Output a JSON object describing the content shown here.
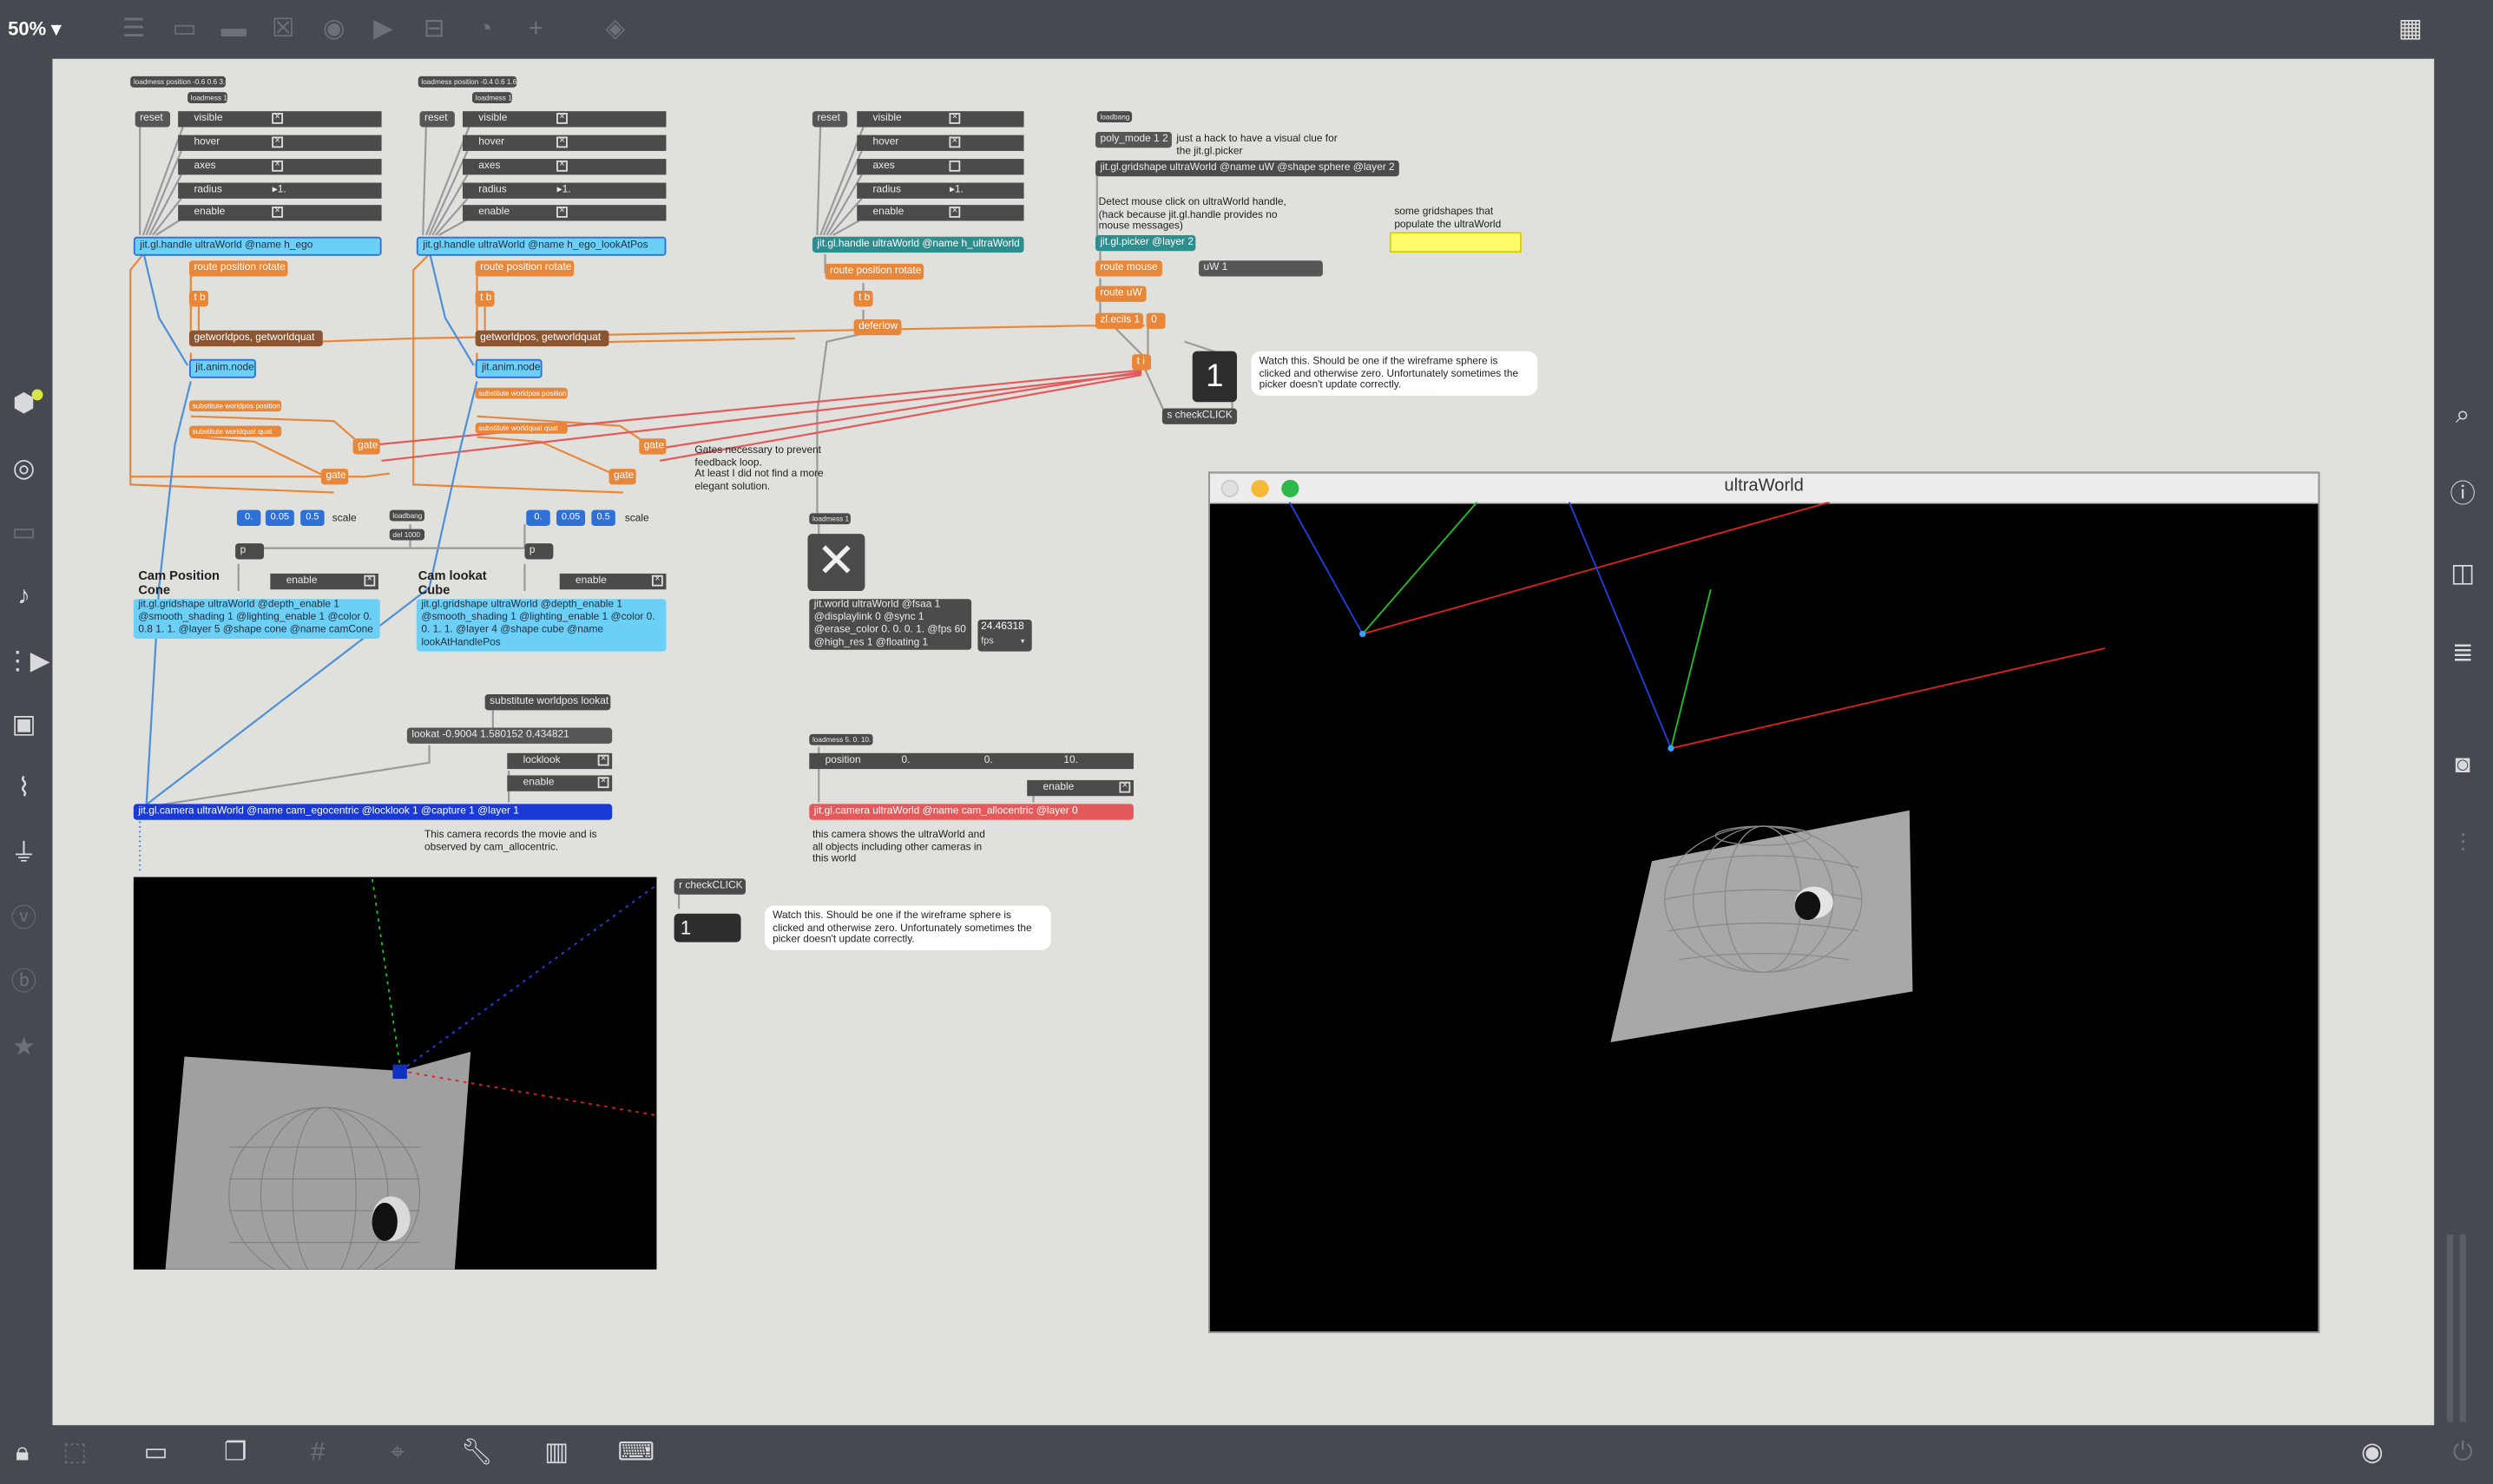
{
  "toolbar": {
    "zoom_label": "50%"
  },
  "colors": {
    "patcher_bg": "#e0e0dc",
    "chrome": "#464950",
    "patch_orange": "#e8873a",
    "patch_cyan": "#6ccff6",
    "patch_blue": "#1a3ad8",
    "patch_red": "#e45a5a",
    "patch_teal": "#2e8d8d"
  },
  "handle1": {
    "loadmess": "loadmess position -0.6 0.6 3.6",
    "loadmess_small": "loadmess 1",
    "reset": "reset",
    "rows": [
      {
        "label": "visible",
        "value": "×"
      },
      {
        "label": "hover",
        "value": "×"
      },
      {
        "label": "axes",
        "value": "×"
      },
      {
        "label": "radius",
        "value": "▸1."
      },
      {
        "label": "enable",
        "value": "×"
      }
    ],
    "object": "jit.gl.handle ultraWorld @name h_ego",
    "route": "route position rotate",
    "t_b": "t b",
    "getworld": "getworldpos, getworldquat",
    "anim": "jit.anim.node",
    "sub_pos": "substitute worldpos position",
    "sub_quat": "substitute worldquat quat",
    "gate1": "gate",
    "gate2": "gate"
  },
  "handle2": {
    "loadmess": "loadmess position -0.4 0.6 1.6",
    "loadmess_small": "loadmess 1",
    "reset": "reset",
    "rows": [
      {
        "label": "visible",
        "value": "×"
      },
      {
        "label": "hover",
        "value": "×"
      },
      {
        "label": "axes",
        "value": "×"
      },
      {
        "label": "radius",
        "value": "▸1."
      },
      {
        "label": "enable",
        "value": "×"
      }
    ],
    "object": "jit.gl.handle ultraWorld @name h_ego_lookAtPos",
    "route": "route position rotate",
    "t_b": "t b",
    "getworld": "getworldpos, getworldquat",
    "anim": "jit.anim.node",
    "sub_pos": "substitute worldpos position",
    "sub_quat": "substitute worldquat quat",
    "gate1": "gate",
    "gate2": "gate"
  },
  "handle3": {
    "reset": "reset",
    "rows": [
      {
        "label": "visible",
        "value": "×"
      },
      {
        "label": "hover",
        "value": "×"
      },
      {
        "label": "axes",
        "value": ""
      },
      {
        "label": "radius",
        "value": "▸1."
      },
      {
        "label": "enable",
        "value": "×"
      }
    ],
    "object": "jit.gl.handle ultraWorld @name h_ultraWorld",
    "route": "route position rotate",
    "t_b": "t b",
    "deferlow": "deferlow"
  },
  "gates_comment": "Gates necessary to prevent\nfeedback loop.\nAt least I did not find a more\nelegant solution.",
  "cone": {
    "nums": [
      "0.",
      "0.05",
      "0.5"
    ],
    "scale": "scale",
    "p": "p",
    "label": "Cam Position\nCone",
    "enable": "enable",
    "object": "jit.gl.gridshape ultraWorld @depth_enable 1\n@smooth_shading 1 @lighting_enable 1 @color 0.\n0.8 1. 1. @layer 5 @shape cone @name camCone"
  },
  "cube": {
    "nums": [
      "0.",
      "0.05",
      "0.5"
    ],
    "scale": "scale",
    "p": "p",
    "label": "Cam lookat\nCube",
    "enable": "enable",
    "object": "jit.gl.gridshape ultraWorld @depth_enable 1\n@smooth_shading 1 @lighting_enable 1 @color 0.\n0. 1. 1. @layer 4 @shape cube @name\nlookAtHandlePos"
  },
  "misc": {
    "loadbang": "loadbang",
    "del": "del 1000",
    "sub_lookat": "substitute worldpos lookat",
    "lookat_msg": "lookat -0.9004 1.580152 0.434821",
    "locklook": "locklook",
    "enable": "enable"
  },
  "ego_camera": {
    "object": "jit.gl.camera ultraWorld @name cam_egocentric @locklook 1 @capture 1 @layer 1",
    "comment": "This camera records the movie and is\nobserved by cam_allocentric."
  },
  "world": {
    "loadmess": "loadmess 1",
    "object": "jit.world ultraWorld @fsaa 1\n@displaylink 0 @sync 1\n@erase_color 0. 0. 0. 1. @fps 60\n@high_res 1 @floating 1",
    "fps_value": "24.46318",
    "fps_label": "fps"
  },
  "allo_camera": {
    "loadmess": "loadmess 5. 0. 10.",
    "position": "position",
    "pos_vals": [
      "0.",
      "0.",
      "10."
    ],
    "enable": "enable",
    "object": "jit.gl.camera ultraWorld @name cam_allocentric @layer 0",
    "comment": "this camera shows the ultraWorld and\nall objects including other cameras in\nthis world"
  },
  "picker": {
    "loadbang": "loadbang",
    "poly_mode": "poly_mode 1 2",
    "hack_comment": "just a hack to have a visual clue for\nthe jit.gl.picker",
    "gridshape": "jit.gl.gridshape ultraWorld @name uW @shape sphere @layer 2",
    "detect_comment": "Detect mouse click on ultraWorld handle,\n(hack because jit.gl.handle provides no\nmouse messages)",
    "picker": "jit.gl.picker @layer 2",
    "route_mouse": "route mouse",
    "uw_msg": "uW 1",
    "route_uw": "route uW",
    "zl": "zl.ecils 1",
    "zero": "0",
    "t_i": "t i",
    "count": "1",
    "send": "s checkCLICK",
    "note": "Watch this. Should be one if the wireframe sphere is\nclicked and otherwise zero. Unfortunately sometimes the\npicker doesn't update correctly.",
    "populate_comment": "some gridshapes that\npopulate the ultraWorld"
  },
  "receive": {
    "object": "r checkCLICK",
    "count": "1",
    "note": "Watch this. Should be one if the wireframe sphere is\nclicked and otherwise zero. Unfortunately sometimes the\npicker doesn't update correctly."
  },
  "floating_window": {
    "title": "ultraWorld"
  }
}
